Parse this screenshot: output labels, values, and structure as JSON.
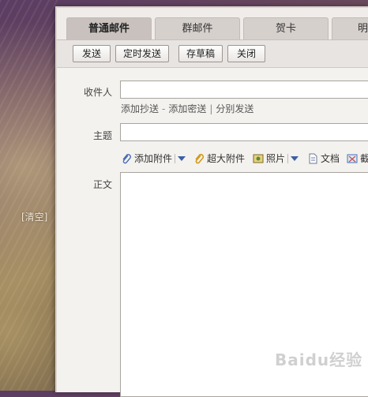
{
  "background": {
    "clear_link": "[清空]"
  },
  "tabs": [
    {
      "label": "普通邮件",
      "active": true
    },
    {
      "label": "群邮件",
      "active": false
    },
    {
      "label": "贺卡",
      "active": false
    },
    {
      "label": "明",
      "active": false
    }
  ],
  "toolbar": {
    "send": "发送",
    "scheduled_send": "定时发送",
    "save_draft": "存草稿",
    "close": "关闭"
  },
  "form": {
    "recipient_label": "收件人",
    "recipient_value": "",
    "add_cc": "添加抄送",
    "dash": "-",
    "add_bcc": "添加密送",
    "pipe": "|",
    "separate_send": "分别发送",
    "subject_label": "主题",
    "subject_value": "",
    "body_label": "正文",
    "body_value": ""
  },
  "attachments": {
    "add_attachment": "添加附件",
    "large_attachment": "超大附件",
    "photo": "照片",
    "document": "文档",
    "screenshot": "截"
  },
  "watermark": "Baidu经验"
}
